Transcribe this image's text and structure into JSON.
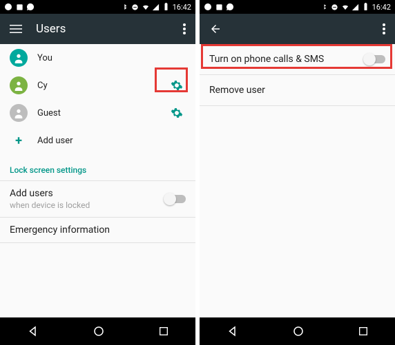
{
  "status": {
    "time": "16:42"
  },
  "left": {
    "toolbar_title": "Users",
    "users": [
      {
        "name": "You",
        "avatar_color": "teal",
        "has_gear": false
      },
      {
        "name": "Cy",
        "avatar_color": "green",
        "has_gear": true
      },
      {
        "name": "Guest",
        "avatar_color": "grey",
        "has_gear": true
      }
    ],
    "add_user_label": "Add user",
    "section_lock": "Lock screen settings",
    "add_users_title": "Add users",
    "add_users_sub": "when device is locked",
    "emergency_label": "Emergency information"
  },
  "right": {
    "option_phone_sms": "Turn on phone calls & SMS",
    "option_remove": "Remove user"
  }
}
